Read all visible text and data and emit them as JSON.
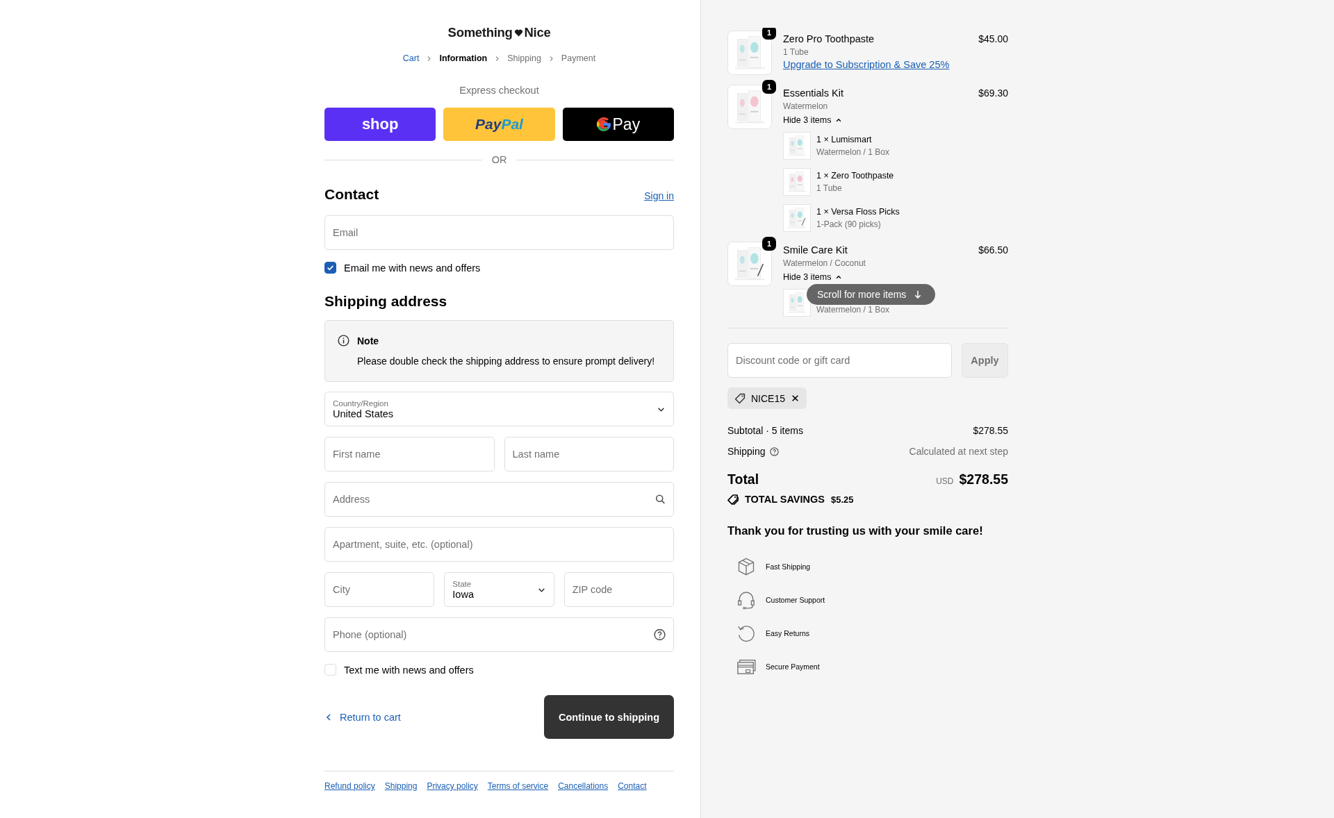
{
  "brand": {
    "left": "Something",
    "right": "Nice"
  },
  "breadcrumbs": [
    {
      "label": "Cart",
      "kind": "link"
    },
    {
      "label": "Information",
      "kind": "current"
    },
    {
      "label": "Shipping",
      "kind": "upcoming"
    },
    {
      "label": "Payment",
      "kind": "upcoming"
    }
  ],
  "express": {
    "title": "Express checkout",
    "divider": "OR",
    "buttons": [
      {
        "kind": "shop",
        "parts": [
          "shop"
        ]
      },
      {
        "kind": "paypal",
        "parts": [
          "Pay",
          "Pal"
        ]
      },
      {
        "kind": "gpay",
        "parts": [
          "Pay"
        ]
      }
    ]
  },
  "contact": {
    "title": "Contact",
    "sign_in": "Sign in",
    "email": {
      "placeholder": "Email"
    },
    "news": {
      "label": "Email me with news and offers",
      "checked": true
    }
  },
  "shipping": {
    "title": "Shipping address",
    "note": {
      "title": "Note",
      "text": "Please double check the shipping address to ensure prompt delivery!"
    },
    "rows": [
      [
        {
          "kind": "select",
          "label": "Country/Region",
          "value": "United States"
        }
      ],
      [
        {
          "kind": "text",
          "placeholder": "First name"
        },
        {
          "kind": "text",
          "placeholder": "Last name"
        }
      ],
      [
        {
          "kind": "search",
          "placeholder": "Address"
        }
      ],
      [
        {
          "kind": "text",
          "placeholder": "Apartment, suite, etc. (optional)"
        }
      ],
      [
        {
          "kind": "text",
          "placeholder": "City"
        },
        {
          "kind": "select",
          "label": "State",
          "value": "Iowa"
        },
        {
          "kind": "text",
          "placeholder": "ZIP code"
        }
      ],
      [
        {
          "kind": "phone",
          "placeholder": "Phone (optional)"
        }
      ]
    ]
  },
  "sms": {
    "label": "Text me with news and offers",
    "checked": false
  },
  "actions": {
    "back": "Return to cart",
    "continue": "Continue to shipping"
  },
  "footer_links": [
    "Refund policy",
    "Shipping",
    "Privacy policy",
    "Terms of service",
    "Cancellations",
    "Contact"
  ],
  "summary": {
    "items": [
      {
        "name": "Zero Pro Toothpaste",
        "detail": "1 Tube",
        "price": "$45.00",
        "quantity": "1",
        "link": "Upgrade to Subscription & Save 25%"
      },
      {
        "name": "Essentials Kit",
        "detail": "Watermelon",
        "price": "$69.30",
        "quantity": "1",
        "toggle": "Hide 3 items",
        "expanded": true,
        "sub_items": [
          {
            "name": "1 × Lumismart",
            "detail": "Watermelon / 1 Box"
          },
          {
            "name": "1 × Zero Toothpaste",
            "detail": "1 Tube"
          },
          {
            "name": "1 × Versa Floss Picks",
            "detail": "1-Pack (90 picks)"
          }
        ]
      },
      {
        "name": "Smile Care Kit",
        "detail": "Watermelon / Coconut",
        "price": "$66.50",
        "quantity": "1",
        "toggle": "Hide 3 items",
        "expanded": true,
        "sub_items": [
          {
            "detail": "Watermelon / 1 Box"
          }
        ]
      }
    ],
    "scroll_hint": "Scroll for more items",
    "discount": {
      "placeholder": "Discount code or gift card",
      "button": "Apply"
    },
    "codes": [
      "NICE15"
    ],
    "subtotal_label": "Subtotal · 5 items",
    "subtotal": "$278.55",
    "shipping_label": "Shipping",
    "shipping_value": "Calculated at next step",
    "total_label": "Total",
    "currency": "USD",
    "total": "$278.55",
    "savings_label": "TOTAL SAVINGS",
    "savings": "$5.25",
    "thanks": "Thank you for trusting us with your smile care!",
    "features": [
      "Fast Shipping",
      "Customer Support",
      "Easy Returns",
      "Secure Payment"
    ]
  }
}
